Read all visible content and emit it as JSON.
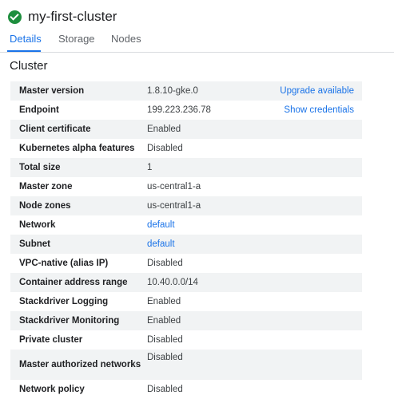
{
  "header": {
    "title": "my-first-cluster"
  },
  "tabs": [
    {
      "label": "Details"
    },
    {
      "label": "Storage"
    },
    {
      "label": "Nodes"
    }
  ],
  "section": {
    "title": "Cluster"
  },
  "rows": [
    {
      "label": "Master version",
      "value": "1.8.10-gke.0",
      "action": "Upgrade available"
    },
    {
      "label": "Endpoint",
      "value": "199.223.236.78",
      "action": "Show credentials"
    },
    {
      "label": "Client certificate",
      "value": "Enabled"
    },
    {
      "label": "Kubernetes alpha features",
      "value": "Disabled"
    },
    {
      "label": "Total size",
      "value": "1"
    },
    {
      "label": "Master zone",
      "value": "us-central1-a"
    },
    {
      "label": "Node zones",
      "value": "us-central1-a"
    },
    {
      "label": "Network",
      "value": "default"
    },
    {
      "label": "Subnet",
      "value": "default"
    },
    {
      "label": "VPC-native (alias IP)",
      "value": "Disabled"
    },
    {
      "label": "Container address range",
      "value": "10.40.0.0/14"
    },
    {
      "label": "Stackdriver Logging",
      "value": "Enabled"
    },
    {
      "label": "Stackdriver Monitoring",
      "value": "Enabled"
    },
    {
      "label": "Private cluster",
      "value": "Disabled"
    },
    {
      "label": "Master authorized networks",
      "value": "Disabled"
    },
    {
      "label": "Network policy",
      "value": "Disabled"
    }
  ]
}
